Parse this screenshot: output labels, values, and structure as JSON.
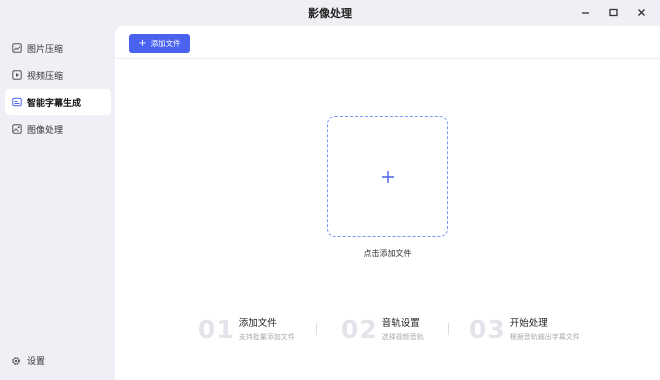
{
  "window": {
    "title": "影像处理",
    "minimize": "−",
    "maximize": "□",
    "close": "✕"
  },
  "sidebar": {
    "items": [
      {
        "label": "图片压缩",
        "icon": "image-compress-icon"
      },
      {
        "label": "视频压缩",
        "icon": "video-compress-icon"
      },
      {
        "label": "智能字幕生成",
        "icon": "subtitle-icon",
        "active": true
      },
      {
        "label": "图像处理",
        "icon": "image-process-icon"
      }
    ],
    "settings_label": "设置"
  },
  "toolbar": {
    "add_label": "添加文件",
    "add_icon": "plus-icon"
  },
  "dropzone": {
    "label": "点击添加文件"
  },
  "steps": [
    {
      "num": "01",
      "title": "添加文件",
      "desc": "支持批量添加文件"
    },
    {
      "num": "02",
      "title": "音轨设置",
      "desc": "选择视频音轨"
    },
    {
      "num": "03",
      "title": "开始处理",
      "desc": "根据音轨输出字幕文件"
    }
  ],
  "colors": {
    "accent": "#4a62f0",
    "sidebar_bg": "#eef0f6",
    "dash": "#7f94f3"
  }
}
